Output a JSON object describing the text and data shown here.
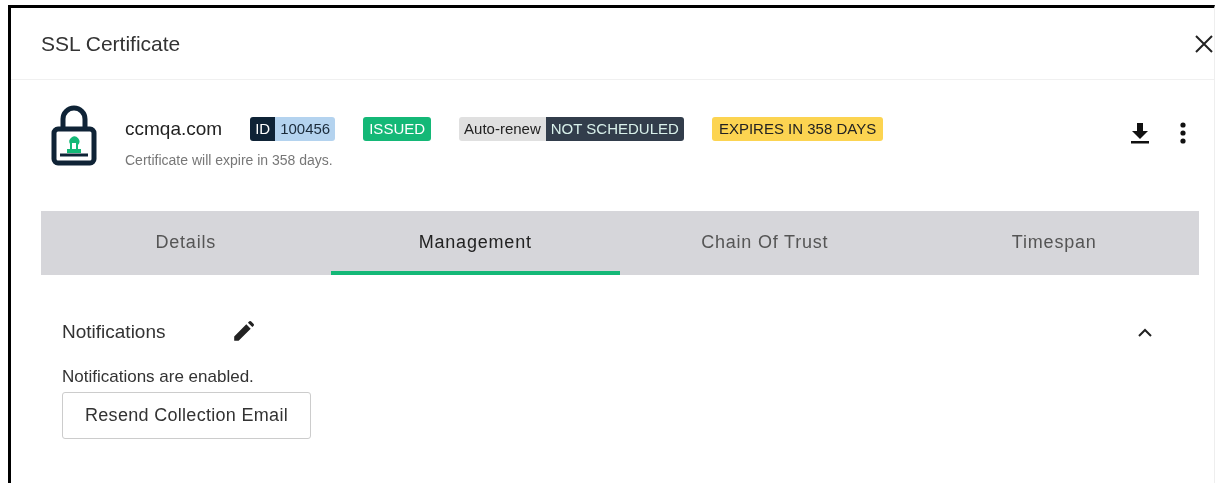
{
  "window": {
    "title": "SSL Certificate"
  },
  "certificate": {
    "domain": "ccmqa.com",
    "id_label": "ID",
    "id_value": "100456",
    "status": "ISSUED",
    "auto_renew_label": "Auto-renew",
    "auto_renew_value": "NOT SCHEDULED",
    "expiry_badge": "EXPIRES IN 358 DAYS",
    "subtitle": "Certificate will expire in 358 days."
  },
  "tabs": [
    {
      "label": "Details",
      "selected": false
    },
    {
      "label": "Management",
      "selected": true
    },
    {
      "label": "Chain Of Trust",
      "selected": false
    },
    {
      "label": "Timespan",
      "selected": false
    }
  ],
  "notifications": {
    "title": "Notifications",
    "expanded": true,
    "status": "Notifications are enabled.",
    "button": "Resend Collection Email"
  }
}
